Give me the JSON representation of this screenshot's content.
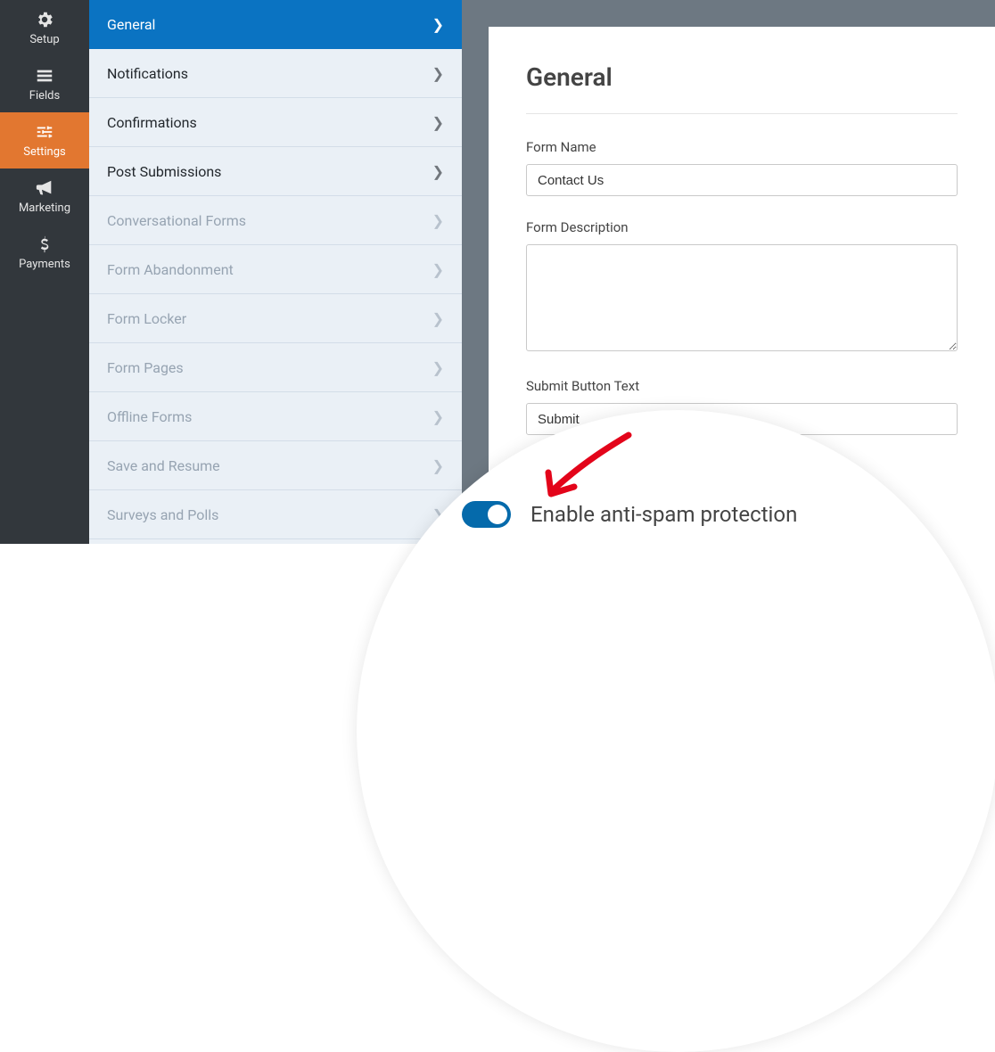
{
  "dark_nav": {
    "items": [
      {
        "label": "Setup"
      },
      {
        "label": "Fields"
      },
      {
        "label": "Settings"
      },
      {
        "label": "Marketing"
      },
      {
        "label": "Payments"
      }
    ]
  },
  "light_nav": {
    "items": [
      {
        "label": "General"
      },
      {
        "label": "Notifications"
      },
      {
        "label": "Confirmations"
      },
      {
        "label": "Post Submissions"
      },
      {
        "label": "Conversational Forms"
      },
      {
        "label": "Form Abandonment"
      },
      {
        "label": "Form Locker"
      },
      {
        "label": "Form Pages"
      },
      {
        "label": "Offline Forms"
      },
      {
        "label": "Save and Resume"
      },
      {
        "label": "Surveys and Polls"
      }
    ]
  },
  "panel": {
    "title": "General",
    "form_name_label": "Form Name",
    "form_name_value": "Contact Us",
    "form_desc_label": "Form Description",
    "form_desc_value": "",
    "submit_label": "Submit Button Text",
    "submit_value": "Submit"
  },
  "callout": {
    "label": "Enable anti-spam protection"
  }
}
